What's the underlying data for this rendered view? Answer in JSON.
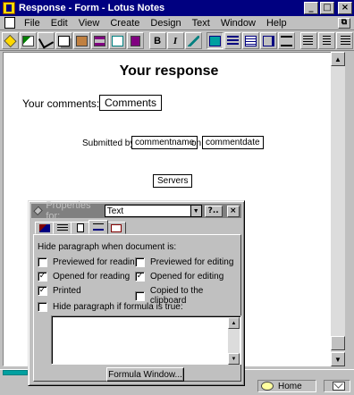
{
  "window": {
    "title": "Response - Form - Lotus Notes"
  },
  "titlebar_buttons": {
    "minimize": "_",
    "maximize": "□",
    "close": "×",
    "restore": "⧉"
  },
  "menu": [
    {
      "label": "File"
    },
    {
      "label": "Edit"
    },
    {
      "label": "View"
    },
    {
      "label": "Create"
    },
    {
      "label": "Design"
    },
    {
      "label": "Text"
    },
    {
      "label": "Window"
    },
    {
      "label": "Help"
    }
  ],
  "toolbar": {
    "icons": [
      "navigator-icon",
      "edit-icon",
      "cut-icon",
      "copy-icon",
      "paste-icon",
      "field-icon",
      "shared-field-icon",
      "section-icon",
      "bold-icon",
      "italic-icon",
      "strikethrough-icon",
      "text-properties-icon",
      "indent-icon",
      "outdent-icon",
      "permanent-pen-icon",
      "align-left-icon",
      "align-center-icon",
      "align-right-icon"
    ],
    "bold_label": "B",
    "italic_label": "I"
  },
  "document": {
    "title": "Your response",
    "comments_label": "Your comments:",
    "comments_field": "Comments",
    "submitted_by": "Submitted by",
    "commentname_field": "commentname",
    "on_label": "on",
    "commentdate_field": "commentdate",
    "servers_field": "Servers"
  },
  "properties": {
    "title_label": "Properties for:",
    "selected": "Text",
    "help_label": "?..",
    "close_label": "×",
    "hide_heading": "Hide paragraph when document is:",
    "options": {
      "previewed_reading": {
        "label": "Previewed for reading",
        "checked": false
      },
      "previewed_editing": {
        "label": "Previewed for editing",
        "checked": false
      },
      "opened_reading": {
        "label": "Opened for reading",
        "checked": true
      },
      "opened_editing": {
        "label": "Opened for editing",
        "checked": true
      },
      "printed": {
        "label": "Printed",
        "checked": true
      },
      "copied_clipboard": {
        "label": "Copied to the clipboard",
        "checked": false
      },
      "hide_formula": {
        "label": "Hide paragraph if formula is true:",
        "checked": false
      }
    },
    "formula_button": "Formula Window..."
  },
  "status": {
    "home": "Home"
  },
  "colors": {
    "titlebar": "#000080",
    "face": "#c0c0c0",
    "doc_bg": "#ffffff"
  }
}
